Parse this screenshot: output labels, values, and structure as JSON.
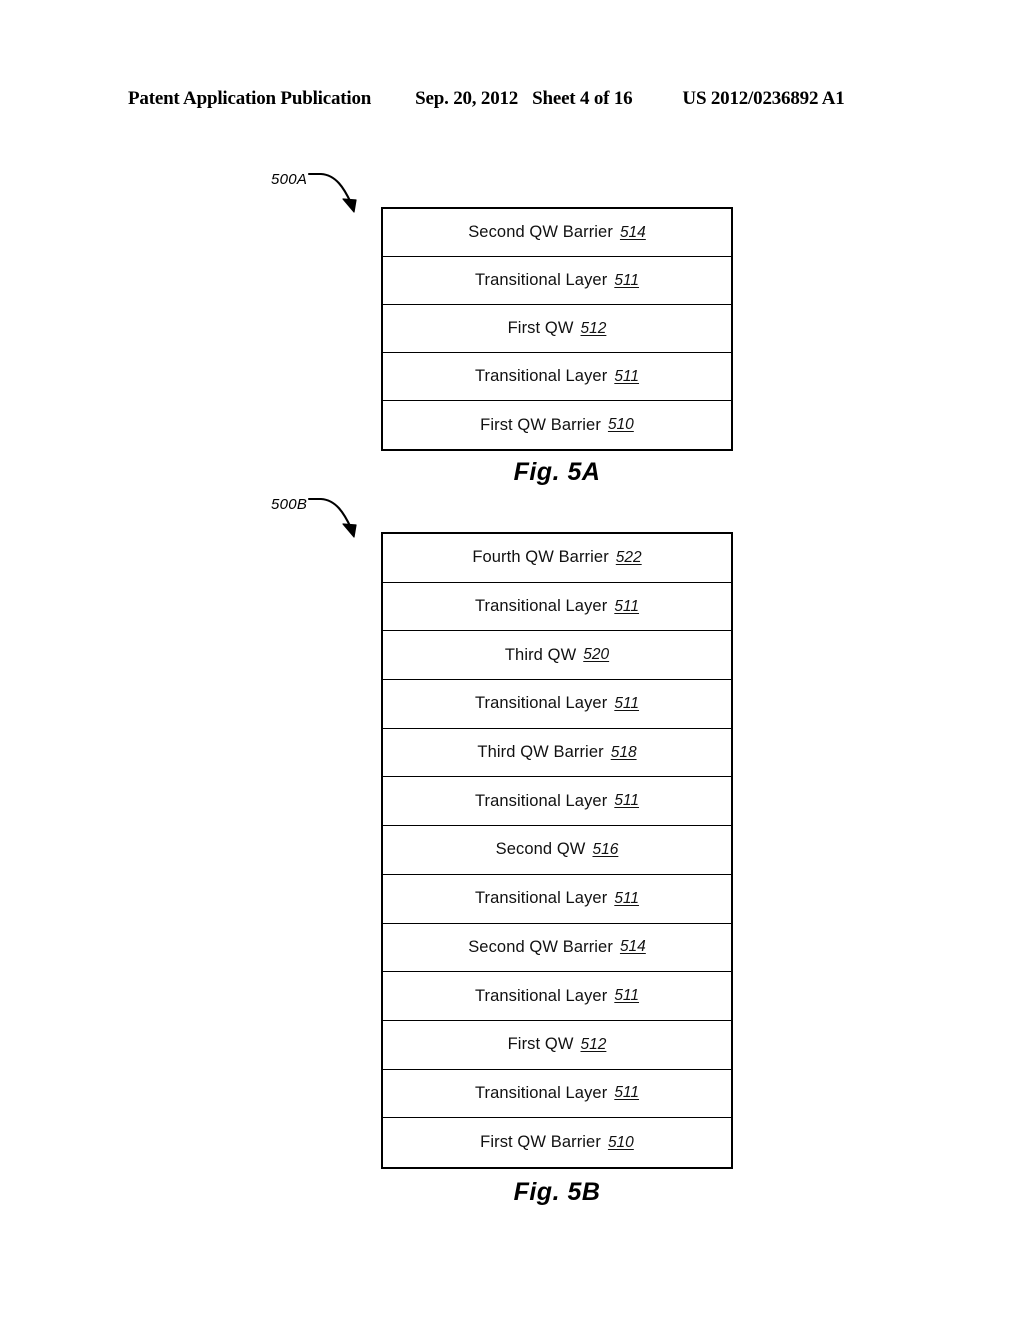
{
  "header": {
    "publication": "Patent Application Publication",
    "date": "Sep. 20, 2012",
    "sheet": "Sheet 4 of 16",
    "doc_number": "US 2012/0236892 A1"
  },
  "figures": [
    {
      "id": "5A",
      "caption": "Fig. 5A",
      "callout": "500A",
      "layers": [
        {
          "label": "Second QW Barrier",
          "ref": "514"
        },
        {
          "label": "Transitional Layer",
          "ref": "511"
        },
        {
          "label": "First QW",
          "ref": "512"
        },
        {
          "label": "Transitional Layer",
          "ref": "511"
        },
        {
          "label": "First QW Barrier",
          "ref": "510"
        }
      ]
    },
    {
      "id": "5B",
      "caption": "Fig. 5B",
      "callout": "500B",
      "layers": [
        {
          "label": "Fourth QW Barrier",
          "ref": "522"
        },
        {
          "label": "Transitional Layer",
          "ref": "511"
        },
        {
          "label": "Third QW",
          "ref": "520"
        },
        {
          "label": "Transitional Layer",
          "ref": "511"
        },
        {
          "label": "Third QW Barrier",
          "ref": "518"
        },
        {
          "label": "Transitional Layer",
          "ref": "511"
        },
        {
          "label": "Second QW",
          "ref": "516"
        },
        {
          "label": "Transitional Layer",
          "ref": "511"
        },
        {
          "label": "Second QW Barrier",
          "ref": "514"
        },
        {
          "label": "Transitional Layer",
          "ref": "511"
        },
        {
          "label": "First QW",
          "ref": "512"
        },
        {
          "label": "Transitional Layer",
          "ref": "511"
        },
        {
          "label": "First QW Barrier",
          "ref": "510"
        }
      ]
    }
  ],
  "colors": {
    "ink": "#000000",
    "page": "#ffffff"
  }
}
